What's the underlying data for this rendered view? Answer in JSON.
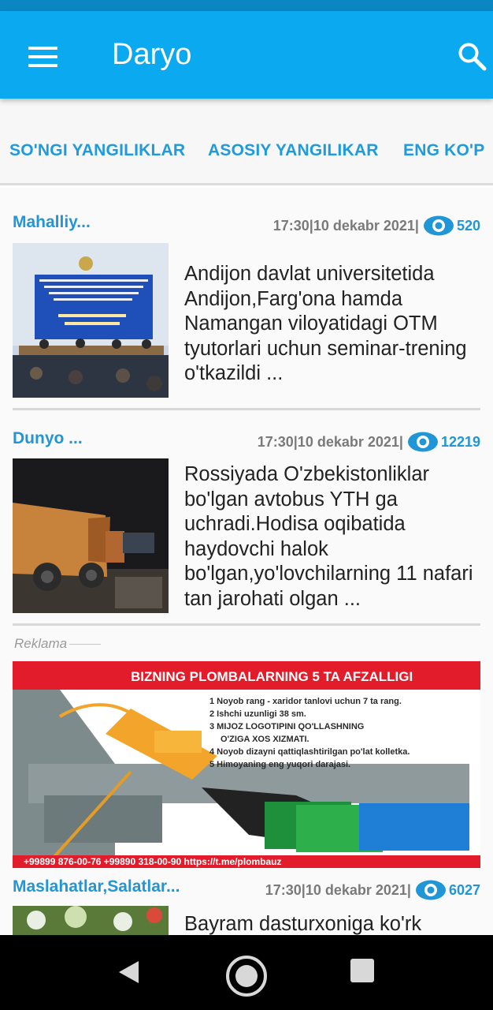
{
  "app": {
    "title": "Daryo"
  },
  "tabs": [
    {
      "label": "SO'NGI YANGILIKLAR"
    },
    {
      "label": "ASOSIY YANGILIKAR"
    },
    {
      "label": "ENG KO'P"
    }
  ],
  "articles": [
    {
      "category": "Mahalliy...",
      "date": "17:30|10 dekabr 2021|",
      "views": "520",
      "headline": "Andijon davlat universitetida Andijon,Farg'ona hamda Namangan viloyatidagi OTM tyutorlari uchun seminar-trening o'tkazildi ..."
    },
    {
      "category": "Dunyo ...",
      "date": "17:30|10 dekabr 2021|",
      "views": "12219",
      "headline": "Rossiyada O'zbekistonliklar bo'lgan avtobus YTH ga uchradi.Hodisa oqibatida haydovchi halok bo'lgan,yo'lovchilarning 11 nafari tan jarohati olgan ..."
    },
    {
      "category": "Maslahatlar,Salatlar...",
      "date": "17:30|10 dekabr 2021|",
      "views": "6027",
      "headline": "Bayram dasturxoniga ko'rk"
    }
  ],
  "ad": {
    "label": "Reklama",
    "headline": "BIZNING PLOMBALARNING 5 TA AFZALLIGI",
    "points": [
      "1 Noyob rang - xaridor tanlovi uchun 7 ta rang.",
      "2 Ishchi uzunligi 38 sm.",
      "3 MIJOZ LOGOTIPINI QO'LLASHNING",
      "O'ZIGA XOS XIZMATI.",
      "4 Noyob dizayni qattiqlashtirilgan po'lat kolletka.",
      "5 Himoyaning eng yuqori darajasi."
    ],
    "contacts": "+99899 876-00-76  +99890 318-00-90  https://t.me/plombauz"
  },
  "colors": {
    "appbar": "#0aa9f0",
    "accent": "#2196d6",
    "statusbar": "#0a87c2"
  },
  "icons": {
    "menu": "hamburger-icon",
    "search": "search-icon",
    "views": "eye-icon"
  }
}
